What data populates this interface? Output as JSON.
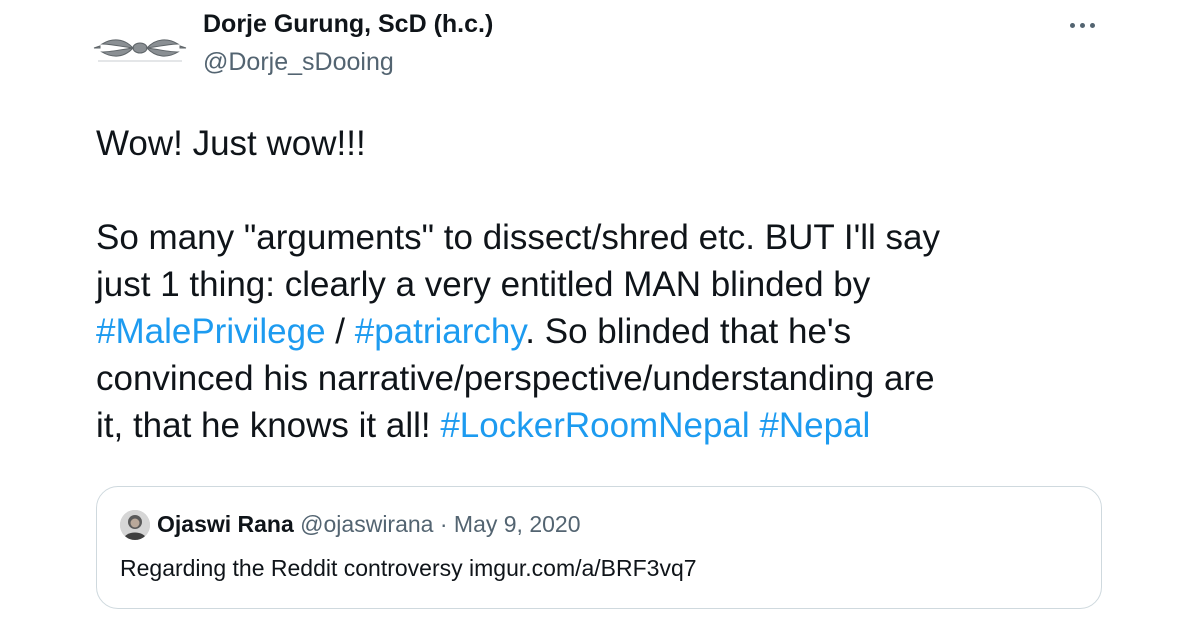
{
  "author": {
    "display_name": "Dorje Gurung, ScD (h.c.)",
    "handle": "@Dorje_sDooing",
    "avatar_icon": "vajra-icon"
  },
  "menu": {
    "icon": "more-horizontal-icon"
  },
  "tweet": {
    "line1": "Wow! Just wow!!!",
    "line2": "So many \"arguments\" to dissect/shred etc. BUT I'll say",
    "line3": "just 1 thing: clearly a very entitled MAN blinded by",
    "line4_tag1": "#MalePrivilege",
    "line4_sep": " / ",
    "line4_tag2": "#patriarchy",
    "line4_rest": ". So blinded that he's",
    "line5": "convinced his narrative/perspective/understanding are",
    "line6_text": "it, that he knows it all! ",
    "line6_tag1": "#LockerRoomNepal",
    "line6_space": " ",
    "line6_tag2": "#Nepal"
  },
  "quote": {
    "name": "Ojaswi Rana",
    "handle": "@ojaswirana",
    "separator": "·",
    "date": "May 9, 2020",
    "text": "Regarding the Reddit controversy imgur.com/a/BRF3vq7"
  },
  "colors": {
    "text": "#0f1419",
    "secondary": "#536471",
    "link": "#1d9bf0",
    "border": "#cfd9de"
  }
}
